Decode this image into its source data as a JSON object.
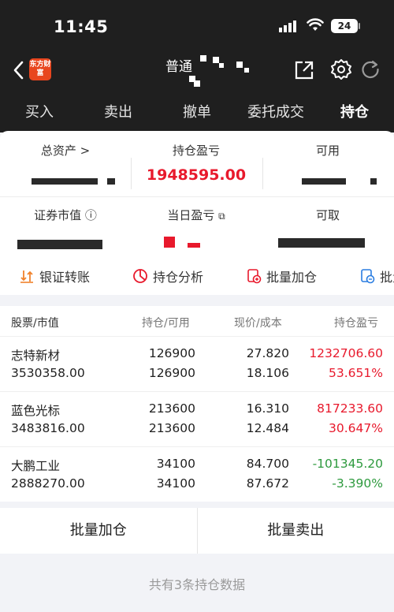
{
  "status_bar": {
    "time": "11:45",
    "battery": "24"
  },
  "navbar": {
    "logo_text": "东方财富",
    "account_label": "普通"
  },
  "tabs": [
    {
      "label": "买入",
      "active": false
    },
    {
      "label": "卖出",
      "active": false
    },
    {
      "label": "撤单",
      "active": false
    },
    {
      "label": "委托成交",
      "active": false
    },
    {
      "label": "持仓",
      "active": true
    }
  ],
  "summary": {
    "total_assets_label": "总资产 >",
    "position_pnl_label": "持仓盈亏",
    "position_pnl_value": "1948595.00",
    "available_label": "可用",
    "market_value_label": "证券市值 ⓘ",
    "daily_pnl_label": "当日盈亏",
    "withdrawable_label": "可取"
  },
  "tools": [
    {
      "label": "银证转账",
      "icon": "transfer-icon"
    },
    {
      "label": "持仓分析",
      "icon": "pie-chart-icon"
    },
    {
      "label": "批量加仓",
      "icon": "batch-add-icon"
    },
    {
      "label": "批量",
      "icon": "batch-icon"
    }
  ],
  "list": {
    "headers": {
      "stock": "股票/市值",
      "position": "持仓/可用",
      "price": "现价/成本",
      "pnl": "持仓盈亏"
    },
    "rows": [
      {
        "name": "志特新材",
        "market_value": "3530358.00",
        "position": "126900",
        "available": "126900",
        "price": "27.820",
        "cost": "18.106",
        "pnl": "1232706.60",
        "pnl_pct": "53.651%",
        "sign": "red"
      },
      {
        "name": "蓝色光标",
        "market_value": "3483816.00",
        "position": "213600",
        "available": "213600",
        "price": "16.310",
        "cost": "12.484",
        "pnl": "817233.60",
        "pnl_pct": "30.647%",
        "sign": "red"
      },
      {
        "name": "大鹏工业",
        "market_value": "2888270.00",
        "position": "34100",
        "available": "34100",
        "price": "84.700",
        "cost": "87.672",
        "pnl": "-101345.20",
        "pnl_pct": "-3.390%",
        "sign": "green"
      }
    ]
  },
  "bottom": {
    "batch_add": "批量加仓",
    "batch_sell": "批量卖出"
  },
  "footer": "共有3条持仓数据",
  "colors": {
    "up": "#e8192c",
    "down": "#2e9a3e",
    "header_bg": "#1f1f1f"
  }
}
